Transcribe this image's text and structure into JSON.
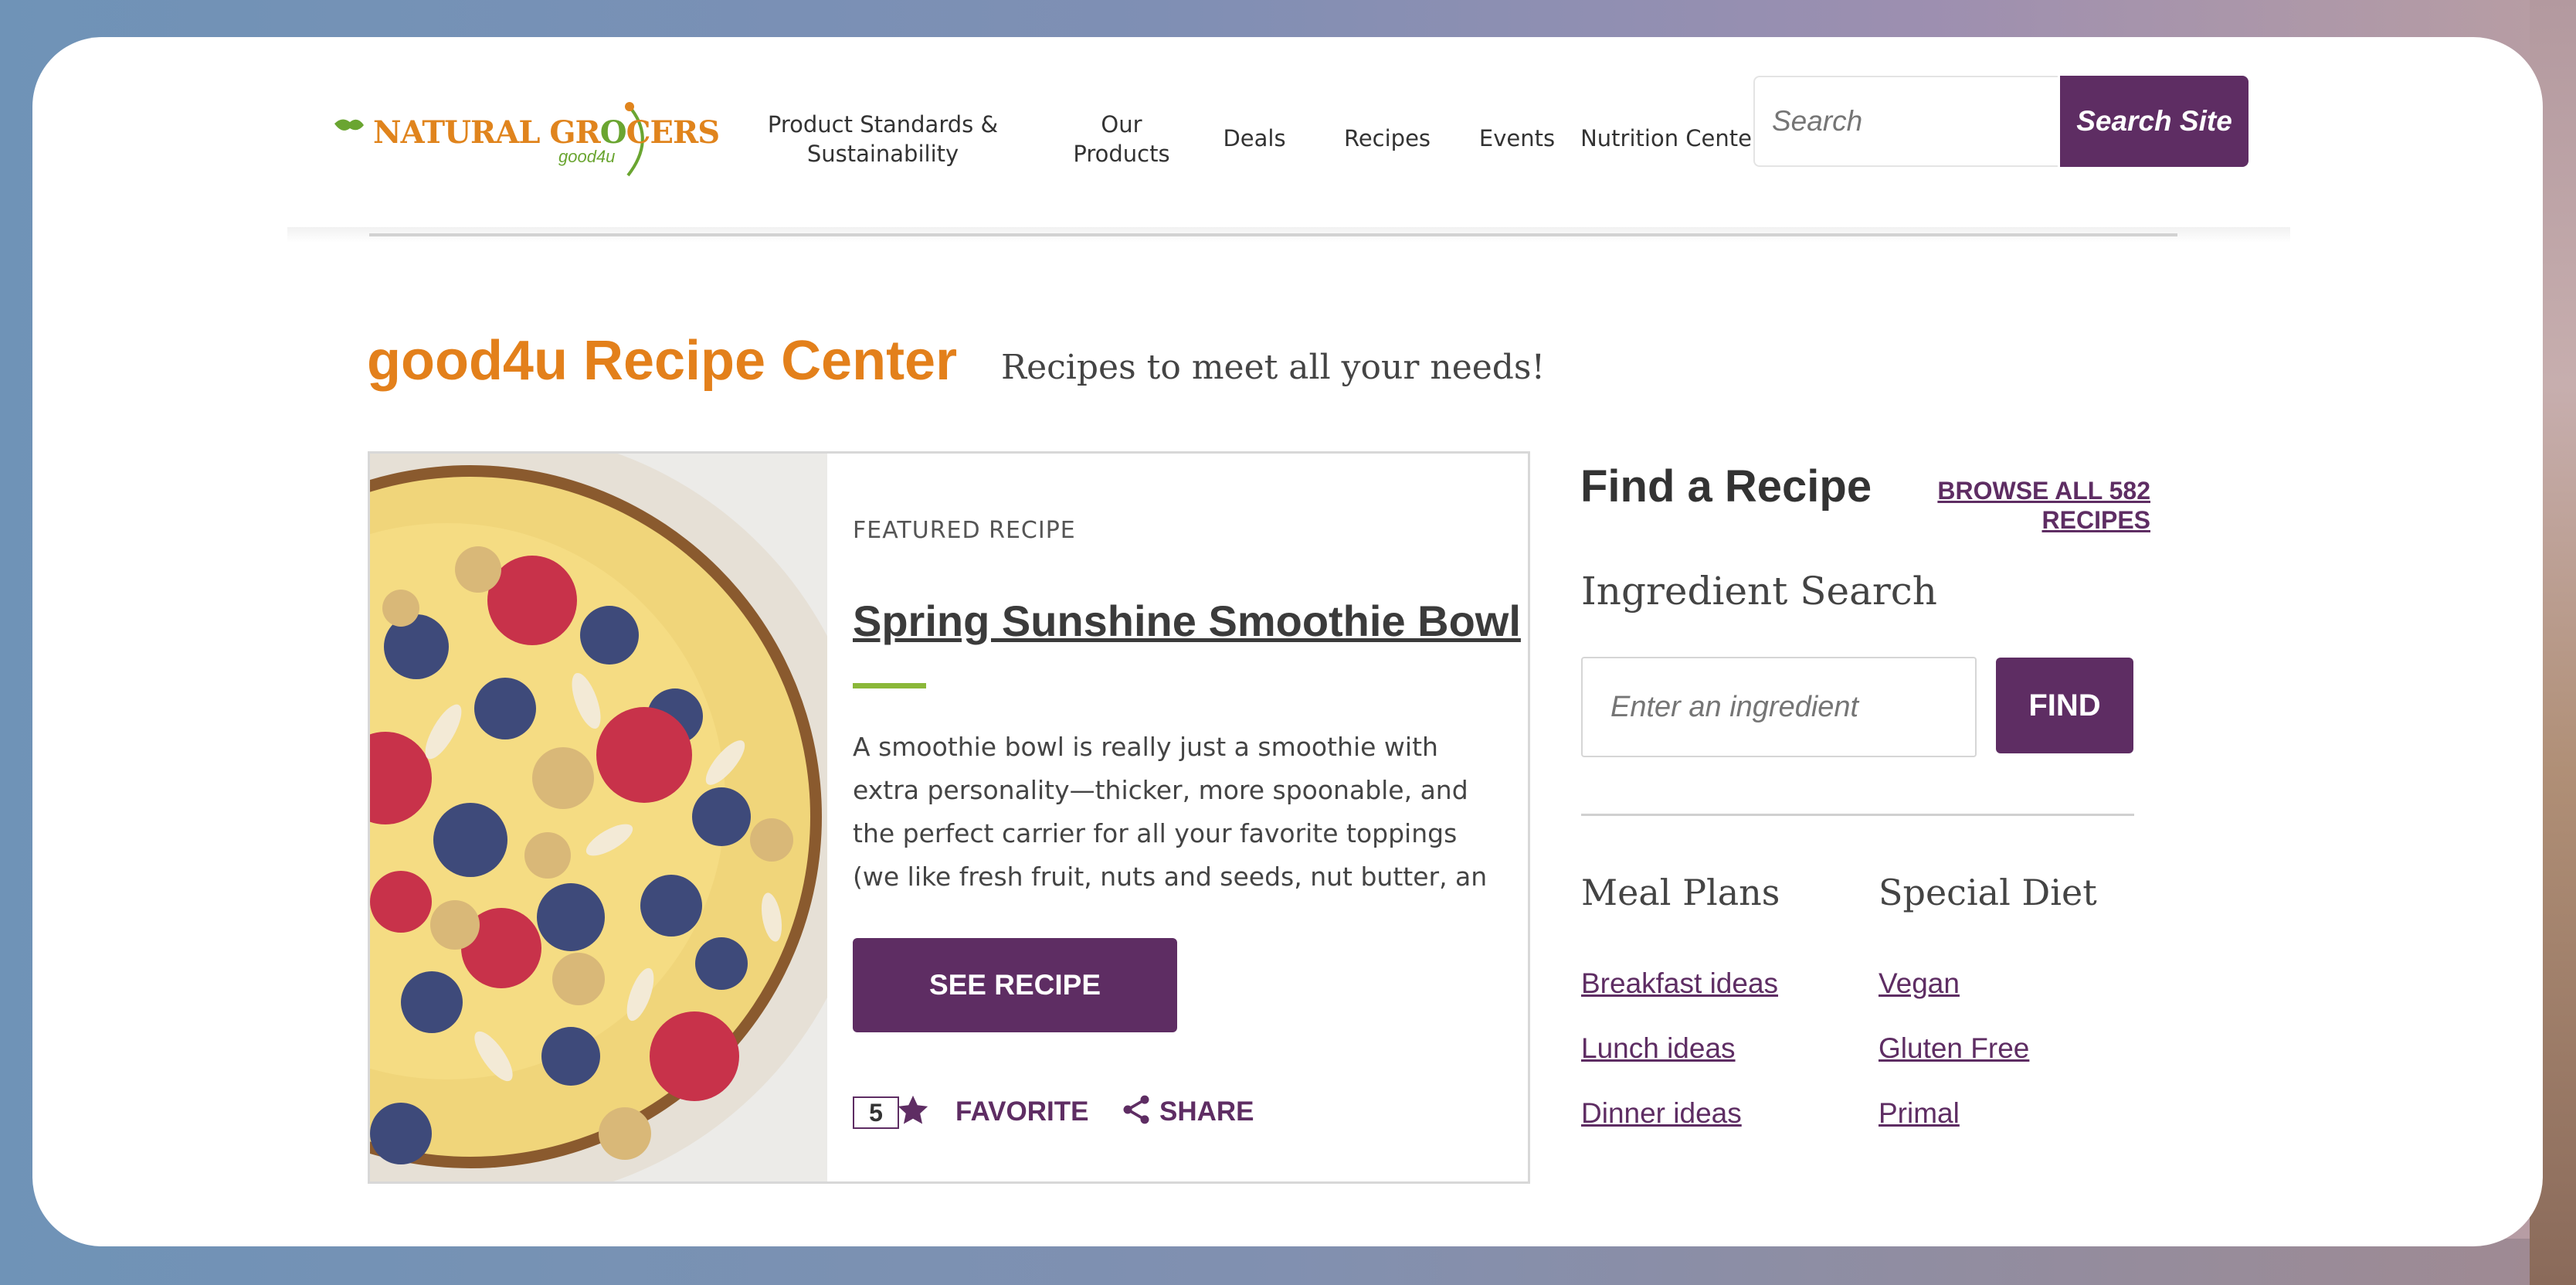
{
  "logo": {
    "primary": "NATURAL GR",
    "accent": "O",
    "rest": "CERS",
    "sub": "good4u"
  },
  "nav": [
    {
      "label": "Product Standards &\nSustainability"
    },
    {
      "label": "Our\nProducts"
    },
    {
      "label": "Deals"
    },
    {
      "label": "Recipes"
    },
    {
      "label": "Events"
    },
    {
      "label": "Nutrition Center"
    }
  ],
  "search": {
    "placeholder": "Search",
    "button": "Search Site"
  },
  "page": {
    "title": "good4u Recipe Center",
    "tagline": "Recipes to meet all your needs!"
  },
  "featured": {
    "label": "FEATURED RECIPE",
    "title": "Spring Sunshine Smoothie Bowl",
    "description": "A smoothie bowl is really just a smoothie with extra personality—thicker, more spoonable, and the perfect carrier for all your favorite toppings (we like fresh fruit, nuts and seeds, nut butter, an",
    "button": "SEE RECIPE",
    "favorite_count": "5",
    "favorite_label": "FAVORITE",
    "share_label": "SHARE"
  },
  "finder": {
    "title": "Find a Recipe",
    "browse_link": "BROWSE ALL 582 RECIPES",
    "ingredient_title": "Ingredient Search",
    "ingredient_placeholder": "Enter an ingredient",
    "find_button": "FIND"
  },
  "meal_plans": {
    "title": "Meal Plans",
    "links": [
      "Breakfast ideas",
      "Lunch ideas",
      "Dinner ideas"
    ]
  },
  "special_diet": {
    "title": "Special Diet",
    "links": [
      "Vegan",
      "Gluten Free",
      "Primal"
    ]
  },
  "colors": {
    "brand_purple": "#5e2d63",
    "title_orange": "#e3801b",
    "accent_green": "#8bb839"
  },
  "icons": [
    "star-icon",
    "share-icon"
  ]
}
